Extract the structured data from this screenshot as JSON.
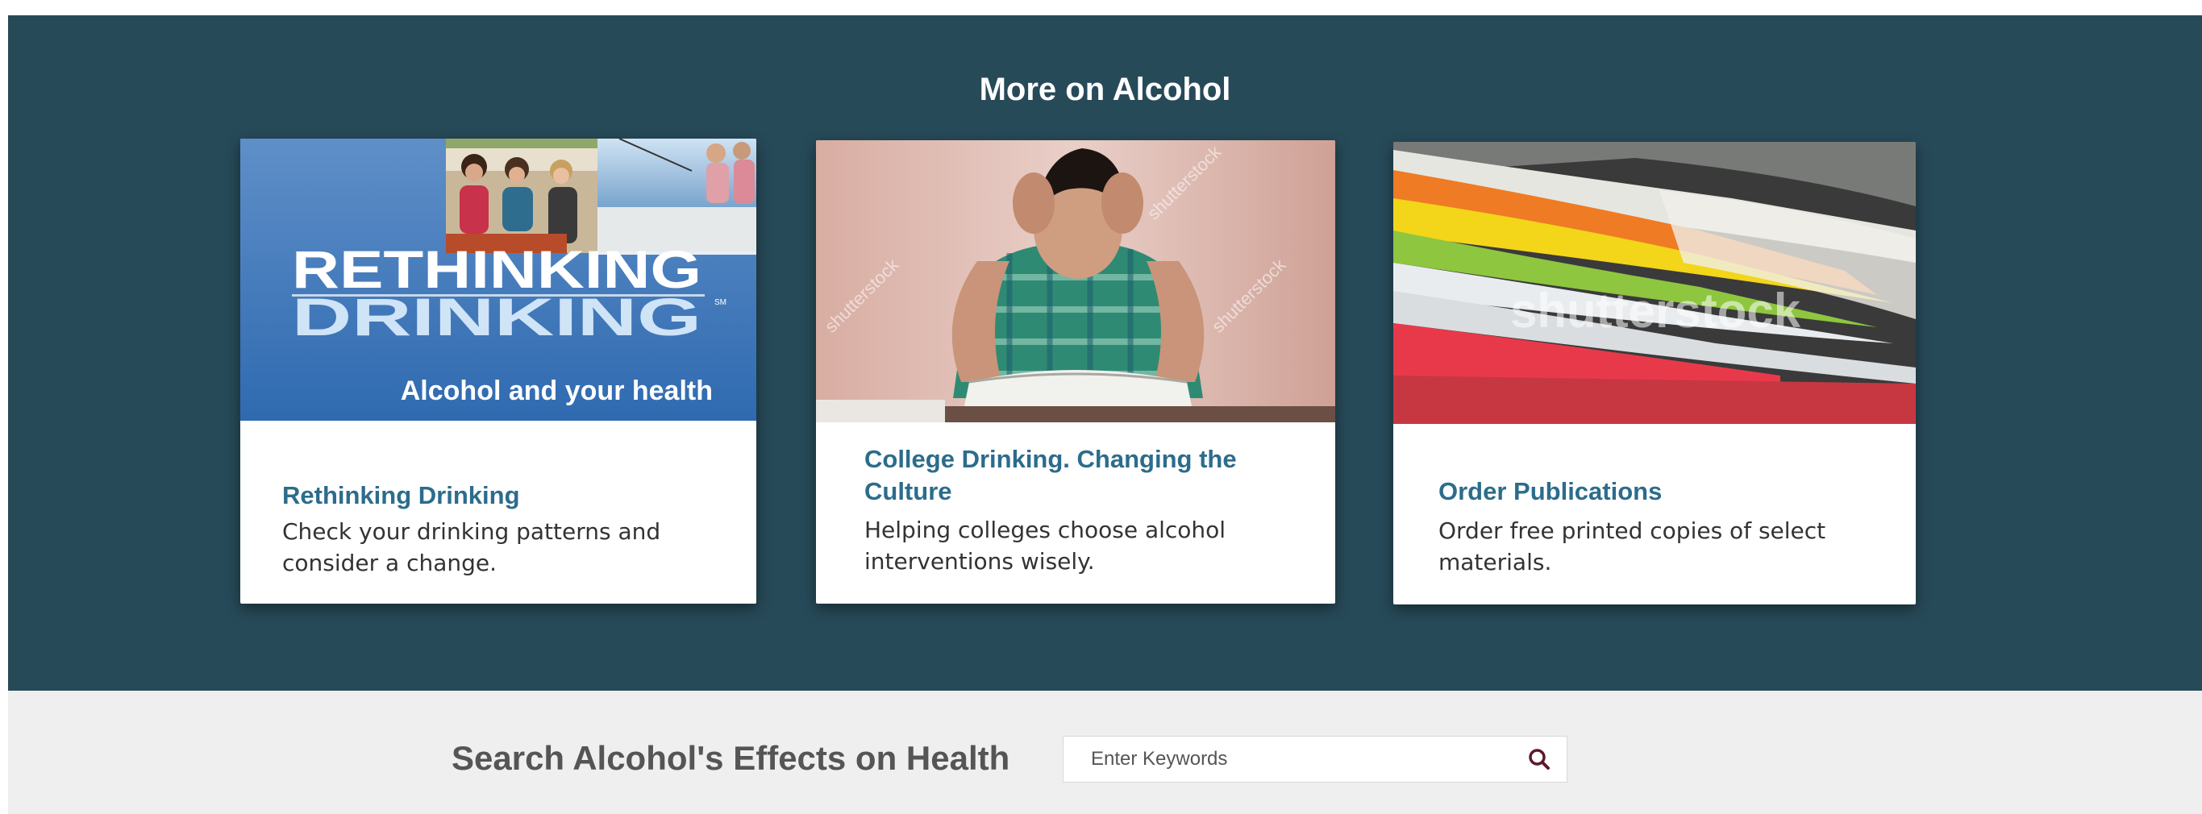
{
  "section": {
    "title": "More on Alcohol",
    "background_color": "#274a59"
  },
  "cards": [
    {
      "title": "Rethinking Drinking",
      "description": "Check your drinking patterns and consider a change.",
      "image": {
        "logo_line1": "RETHINKING",
        "logo_line2": "DRINKING",
        "trademark": "SM",
        "subtitle": "Alcohol and your health"
      }
    },
    {
      "title": "College Drinking. Changing the Culture",
      "description": "Helping colleges choose alcohol interventions wisely.",
      "image": {
        "watermark": "shutterstock"
      }
    },
    {
      "title": "Order Publications",
      "description": "Order free printed copies of select materials.",
      "image": {
        "watermark": "shutterstock"
      }
    }
  ],
  "search": {
    "heading": "Search Alcohol's Effects on Health",
    "placeholder": "Enter Keywords",
    "button_icon": "search-icon"
  },
  "colors": {
    "link_title": "#2c6c8c",
    "search_band": "#efefef",
    "search_icon": "#5a1a2a"
  }
}
